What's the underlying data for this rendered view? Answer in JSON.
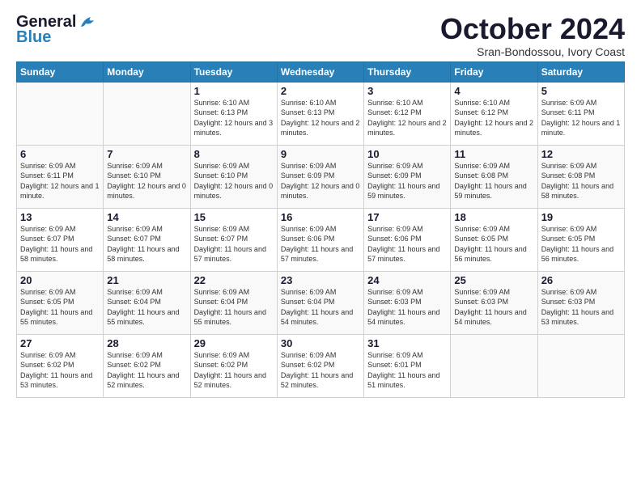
{
  "header": {
    "logo_general": "General",
    "logo_blue": "Blue",
    "title": "October 2024",
    "location": "Sran-Bondossou, Ivory Coast"
  },
  "days_of_week": [
    "Sunday",
    "Monday",
    "Tuesday",
    "Wednesday",
    "Thursday",
    "Friday",
    "Saturday"
  ],
  "weeks": [
    [
      {
        "day": "",
        "sunrise": "",
        "sunset": "",
        "daylight": ""
      },
      {
        "day": "",
        "sunrise": "",
        "sunset": "",
        "daylight": ""
      },
      {
        "day": "1",
        "sunrise": "Sunrise: 6:10 AM",
        "sunset": "Sunset: 6:13 PM",
        "daylight": "Daylight: 12 hours and 3 minutes."
      },
      {
        "day": "2",
        "sunrise": "Sunrise: 6:10 AM",
        "sunset": "Sunset: 6:13 PM",
        "daylight": "Daylight: 12 hours and 2 minutes."
      },
      {
        "day": "3",
        "sunrise": "Sunrise: 6:10 AM",
        "sunset": "Sunset: 6:12 PM",
        "daylight": "Daylight: 12 hours and 2 minutes."
      },
      {
        "day": "4",
        "sunrise": "Sunrise: 6:10 AM",
        "sunset": "Sunset: 6:12 PM",
        "daylight": "Daylight: 12 hours and 2 minutes."
      },
      {
        "day": "5",
        "sunrise": "Sunrise: 6:09 AM",
        "sunset": "Sunset: 6:11 PM",
        "daylight": "Daylight: 12 hours and 1 minute."
      }
    ],
    [
      {
        "day": "6",
        "sunrise": "Sunrise: 6:09 AM",
        "sunset": "Sunset: 6:11 PM",
        "daylight": "Daylight: 12 hours and 1 minute."
      },
      {
        "day": "7",
        "sunrise": "Sunrise: 6:09 AM",
        "sunset": "Sunset: 6:10 PM",
        "daylight": "Daylight: 12 hours and 0 minutes."
      },
      {
        "day": "8",
        "sunrise": "Sunrise: 6:09 AM",
        "sunset": "Sunset: 6:10 PM",
        "daylight": "Daylight: 12 hours and 0 minutes."
      },
      {
        "day": "9",
        "sunrise": "Sunrise: 6:09 AM",
        "sunset": "Sunset: 6:09 PM",
        "daylight": "Daylight: 12 hours and 0 minutes."
      },
      {
        "day": "10",
        "sunrise": "Sunrise: 6:09 AM",
        "sunset": "Sunset: 6:09 PM",
        "daylight": "Daylight: 11 hours and 59 minutes."
      },
      {
        "day": "11",
        "sunrise": "Sunrise: 6:09 AM",
        "sunset": "Sunset: 6:08 PM",
        "daylight": "Daylight: 11 hours and 59 minutes."
      },
      {
        "day": "12",
        "sunrise": "Sunrise: 6:09 AM",
        "sunset": "Sunset: 6:08 PM",
        "daylight": "Daylight: 11 hours and 58 minutes."
      }
    ],
    [
      {
        "day": "13",
        "sunrise": "Sunrise: 6:09 AM",
        "sunset": "Sunset: 6:07 PM",
        "daylight": "Daylight: 11 hours and 58 minutes."
      },
      {
        "day": "14",
        "sunrise": "Sunrise: 6:09 AM",
        "sunset": "Sunset: 6:07 PM",
        "daylight": "Daylight: 11 hours and 58 minutes."
      },
      {
        "day": "15",
        "sunrise": "Sunrise: 6:09 AM",
        "sunset": "Sunset: 6:07 PM",
        "daylight": "Daylight: 11 hours and 57 minutes."
      },
      {
        "day": "16",
        "sunrise": "Sunrise: 6:09 AM",
        "sunset": "Sunset: 6:06 PM",
        "daylight": "Daylight: 11 hours and 57 minutes."
      },
      {
        "day": "17",
        "sunrise": "Sunrise: 6:09 AM",
        "sunset": "Sunset: 6:06 PM",
        "daylight": "Daylight: 11 hours and 57 minutes."
      },
      {
        "day": "18",
        "sunrise": "Sunrise: 6:09 AM",
        "sunset": "Sunset: 6:05 PM",
        "daylight": "Daylight: 11 hours and 56 minutes."
      },
      {
        "day": "19",
        "sunrise": "Sunrise: 6:09 AM",
        "sunset": "Sunset: 6:05 PM",
        "daylight": "Daylight: 11 hours and 56 minutes."
      }
    ],
    [
      {
        "day": "20",
        "sunrise": "Sunrise: 6:09 AM",
        "sunset": "Sunset: 6:05 PM",
        "daylight": "Daylight: 11 hours and 55 minutes."
      },
      {
        "day": "21",
        "sunrise": "Sunrise: 6:09 AM",
        "sunset": "Sunset: 6:04 PM",
        "daylight": "Daylight: 11 hours and 55 minutes."
      },
      {
        "day": "22",
        "sunrise": "Sunrise: 6:09 AM",
        "sunset": "Sunset: 6:04 PM",
        "daylight": "Daylight: 11 hours and 55 minutes."
      },
      {
        "day": "23",
        "sunrise": "Sunrise: 6:09 AM",
        "sunset": "Sunset: 6:04 PM",
        "daylight": "Daylight: 11 hours and 54 minutes."
      },
      {
        "day": "24",
        "sunrise": "Sunrise: 6:09 AM",
        "sunset": "Sunset: 6:03 PM",
        "daylight": "Daylight: 11 hours and 54 minutes."
      },
      {
        "day": "25",
        "sunrise": "Sunrise: 6:09 AM",
        "sunset": "Sunset: 6:03 PM",
        "daylight": "Daylight: 11 hours and 54 minutes."
      },
      {
        "day": "26",
        "sunrise": "Sunrise: 6:09 AM",
        "sunset": "Sunset: 6:03 PM",
        "daylight": "Daylight: 11 hours and 53 minutes."
      }
    ],
    [
      {
        "day": "27",
        "sunrise": "Sunrise: 6:09 AM",
        "sunset": "Sunset: 6:02 PM",
        "daylight": "Daylight: 11 hours and 53 minutes."
      },
      {
        "day": "28",
        "sunrise": "Sunrise: 6:09 AM",
        "sunset": "Sunset: 6:02 PM",
        "daylight": "Daylight: 11 hours and 52 minutes."
      },
      {
        "day": "29",
        "sunrise": "Sunrise: 6:09 AM",
        "sunset": "Sunset: 6:02 PM",
        "daylight": "Daylight: 11 hours and 52 minutes."
      },
      {
        "day": "30",
        "sunrise": "Sunrise: 6:09 AM",
        "sunset": "Sunset: 6:02 PM",
        "daylight": "Daylight: 11 hours and 52 minutes."
      },
      {
        "day": "31",
        "sunrise": "Sunrise: 6:09 AM",
        "sunset": "Sunset: 6:01 PM",
        "daylight": "Daylight: 11 hours and 51 minutes."
      },
      {
        "day": "",
        "sunrise": "",
        "sunset": "",
        "daylight": ""
      },
      {
        "day": "",
        "sunrise": "",
        "sunset": "",
        "daylight": ""
      }
    ]
  ]
}
